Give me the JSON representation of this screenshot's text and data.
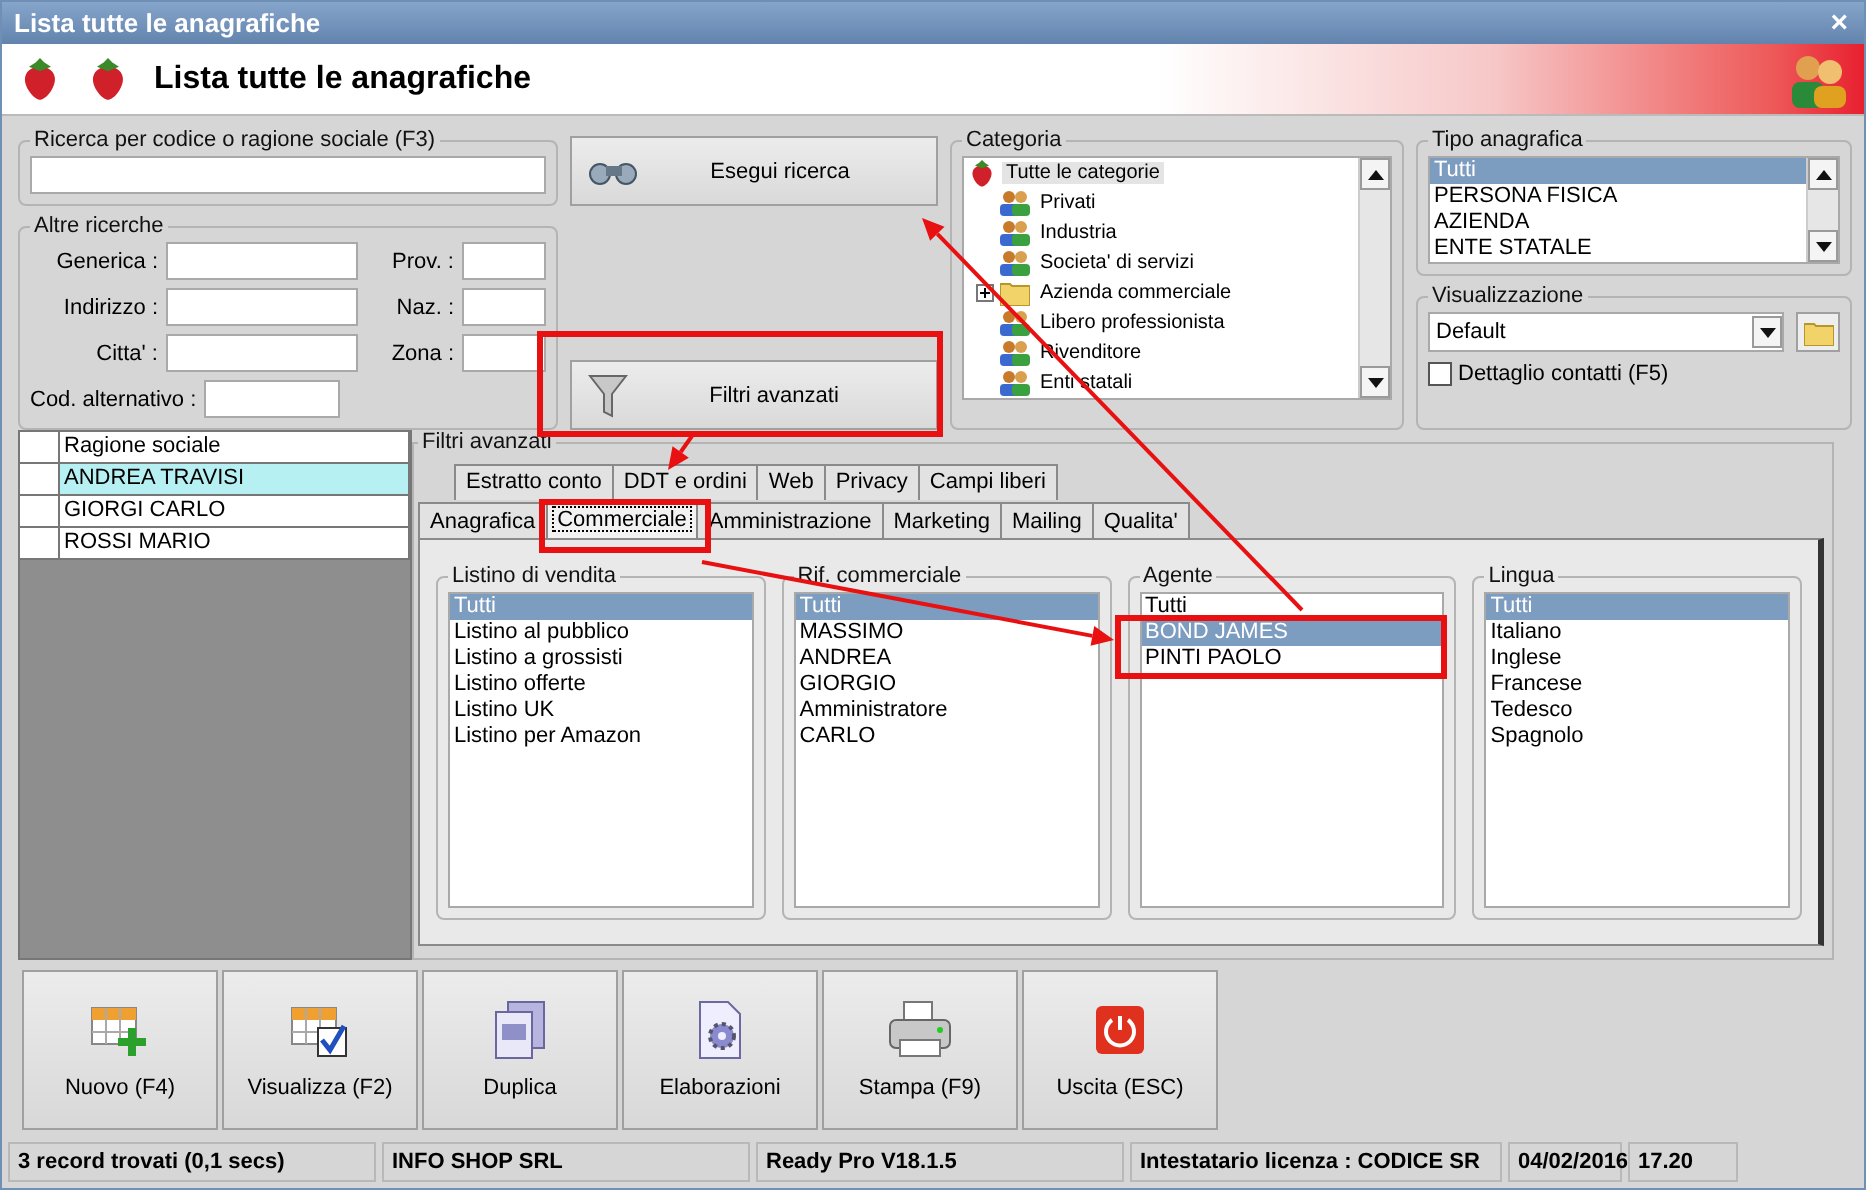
{
  "window": {
    "title": "Lista tutte le anagrafiche",
    "close": "×"
  },
  "header": {
    "title": "Lista tutte le anagrafiche"
  },
  "search": {
    "label": "Ricerca per codice o ragione sociale (F3)"
  },
  "other_searches": {
    "title": "Altre ricerche",
    "fields": [
      {
        "label": "Generica :"
      },
      {
        "label": "Prov. :"
      },
      {
        "label": "Indirizzo :"
      },
      {
        "label": "Naz. :"
      },
      {
        "label": "Citta' :"
      },
      {
        "label": "Zona :"
      }
    ],
    "alt_code": {
      "label": "Cod. alternativo :"
    }
  },
  "search_button": "Esegui ricerca",
  "filter_button": "Filtri avanzati",
  "category": {
    "title": "Categoria",
    "root": {
      "label": "Tutte le categorie",
      "selected": true,
      "children": [
        {
          "label": "Privati",
          "kind": "people",
          "selected": false,
          "has_children": false
        },
        {
          "label": "Industria",
          "kind": "people",
          "selected": false,
          "has_children": false
        },
        {
          "label": "Societa' di servizi",
          "kind": "people",
          "selected": false,
          "has_children": false
        },
        {
          "label": "Azienda commerciale",
          "kind": "folder",
          "selected": false,
          "has_children": true
        },
        {
          "label": "Libero professionista",
          "kind": "people",
          "selected": false,
          "has_children": false
        },
        {
          "label": "Rivenditore",
          "kind": "people",
          "selected": false,
          "has_children": false
        },
        {
          "label": "Enti statali",
          "kind": "people",
          "selected": false,
          "has_children": false
        }
      ]
    }
  },
  "type": {
    "title": "Tipo anagrafica",
    "items": [
      {
        "label": "Tutti",
        "selected": true
      },
      {
        "label": "PERSONA FISICA",
        "selected": false
      },
      {
        "label": "AZIENDA",
        "selected": false
      },
      {
        "label": "ENTE STATALE",
        "selected": false
      }
    ]
  },
  "view": {
    "title": "Visualizzazione",
    "value": "Default",
    "contacts": {
      "label": "Dettaglio contatti (F5)",
      "checked": false
    }
  },
  "table": {
    "column": "Ragione sociale",
    "rows": [
      {
        "name": "ANDREA TRAVISI",
        "selected": true
      },
      {
        "name": "GIORGI CARLO",
        "selected": false
      },
      {
        "name": "ROSSI MARIO",
        "selected": false
      }
    ]
  },
  "filters": {
    "title": "Filtri avanzati",
    "tab_rows": [
      [
        {
          "label": "Estratto conto",
          "selected": false
        },
        {
          "label": "DDT e ordini",
          "selected": false
        },
        {
          "label": "Web",
          "selected": false
        },
        {
          "label": "Privacy",
          "selected": false
        },
        {
          "label": "Campi liberi",
          "selected": false
        }
      ],
      [
        {
          "label": "Anagrafica",
          "selected": false
        },
        {
          "label": "Commerciale",
          "selected": true
        },
        {
          "label": "Amministrazione",
          "selected": false
        },
        {
          "label": "Marketing",
          "selected": false
        },
        {
          "label": "Mailing",
          "selected": false
        },
        {
          "label": "Qualita'",
          "selected": false
        }
      ]
    ],
    "groups": [
      {
        "title": "Listino di vendita",
        "items": [
          {
            "label": "Tutti",
            "selected": true
          },
          {
            "label": "Listino al pubblico",
            "selected": false
          },
          {
            "label": "Listino a grossisti",
            "selected": false
          },
          {
            "label": "Listino offerte",
            "selected": false
          },
          {
            "label": "Listino UK",
            "selected": false
          },
          {
            "label": "Listino per Amazon",
            "selected": false
          }
        ]
      },
      {
        "title": "Rif. commerciale",
        "items": [
          {
            "label": "Tutti",
            "selected": true
          },
          {
            "label": "MASSIMO",
            "selected": false
          },
          {
            "label": "ANDREA",
            "selected": false
          },
          {
            "label": "GIORGIO",
            "selected": false
          },
          {
            "label": "Amministratore",
            "selected": false
          },
          {
            "label": "CARLO",
            "selected": false
          }
        ]
      },
      {
        "title": "Agente",
        "items": [
          {
            "label": "Tutti",
            "selected": false
          },
          {
            "label": "BOND JAMES",
            "selected": true
          },
          {
            "label": "PINTI PAOLO",
            "selected": false
          }
        ]
      },
      {
        "title": "Lingua",
        "items": [
          {
            "label": "Tutti",
            "selected": true
          },
          {
            "label": "Italiano",
            "selected": false
          },
          {
            "label": "Inglese",
            "selected": false
          },
          {
            "label": "Francese",
            "selected": false
          },
          {
            "label": "Tedesco",
            "selected": false
          },
          {
            "label": "Spagnolo",
            "selected": false
          }
        ]
      }
    ]
  },
  "toolbar": [
    {
      "label": "Nuovo (F4)",
      "kind": "new"
    },
    {
      "label": "Visualizza (F2)",
      "kind": "view"
    },
    {
      "label": "Duplica",
      "kind": "duplicate"
    },
    {
      "label": "Elaborazioni",
      "kind": "process"
    },
    {
      "label": "Stampa (F9)",
      "kind": "print"
    },
    {
      "label": "Uscita (ESC)",
      "kind": "exit"
    }
  ],
  "status_bar": [
    "3 record trovati (0,1 secs)",
    "INFO SHOP SRL",
    "Ready Pro V18.1.5",
    "Intestatario licenza : CODICE SR",
    "04/02/2016",
    "17.20"
  ]
}
